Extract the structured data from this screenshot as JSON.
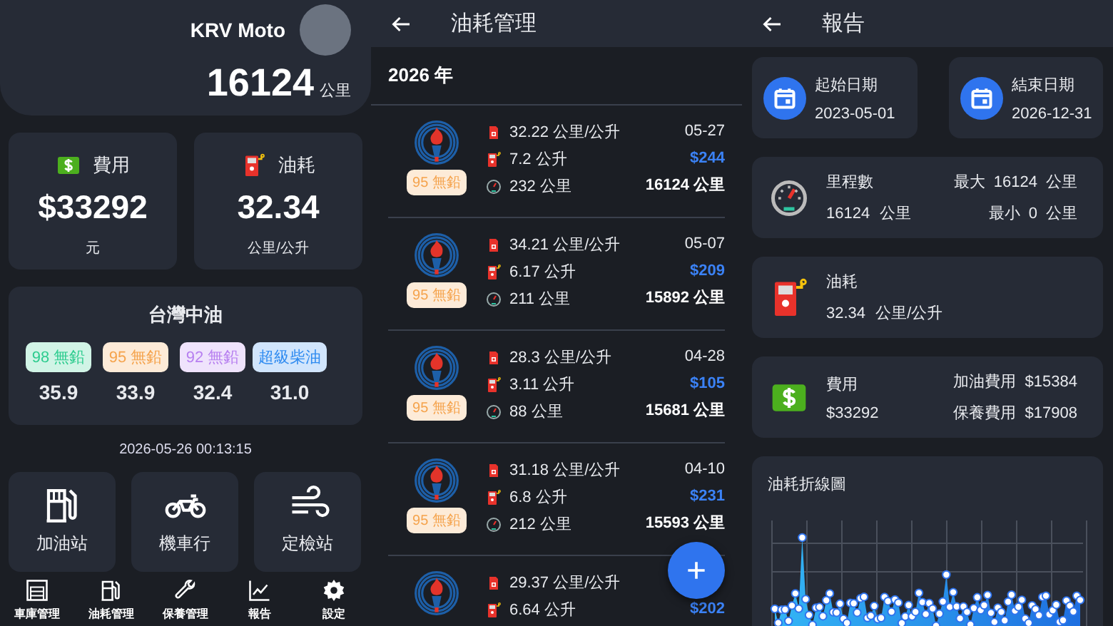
{
  "home": {
    "vehicle_name": "KRV Moto",
    "odometer": "16124",
    "odometer_unit": "公里",
    "stats": [
      {
        "kind": "cost",
        "label": "費用",
        "value": "$33292",
        "unit": "元"
      },
      {
        "kind": "fuel",
        "label": "油耗",
        "value": "32.34",
        "unit": "公里/公升"
      }
    ],
    "prices": {
      "title": "台灣中油",
      "items": [
        {
          "label": "98 無鉛",
          "color": "#2ecc8f",
          "price": "35.9"
        },
        {
          "label": "95 無鉛",
          "color": "#f5a34c",
          "price": "33.9"
        },
        {
          "label": "92 無鉛",
          "color": "#b77ff0",
          "price": "32.4"
        },
        {
          "label": "超級柴油",
          "color": "#2f8bf0",
          "price": "31.0"
        }
      ]
    },
    "timestamp": "2026-05-26 00:13:15",
    "shortcuts": [
      {
        "kind": "gas_station",
        "label": "加油站"
      },
      {
        "kind": "motorcycle",
        "label": "機車行"
      },
      {
        "kind": "inspection",
        "label": "定檢站"
      }
    ],
    "nav": [
      {
        "kind": "garage",
        "label": "車庫管理"
      },
      {
        "kind": "fuel",
        "label": "油耗管理"
      },
      {
        "kind": "maintenance",
        "label": "保養管理"
      },
      {
        "kind": "report",
        "label": "報告"
      },
      {
        "kind": "settings",
        "label": "設定"
      }
    ]
  },
  "fuel_log": {
    "title": "油耗管理",
    "year": "2026 年",
    "records": [
      {
        "fuel": "95 無鉛",
        "color": "#f5a34c",
        "efficiency": "32.22 公里/公升",
        "liters": "7.2 公升",
        "distance": "232 公里",
        "date": "05-27",
        "cost": "$244",
        "odometer": "16124 公里"
      },
      {
        "fuel": "95 無鉛",
        "color": "#f5a34c",
        "efficiency": "34.21 公里/公升",
        "liters": "6.17 公升",
        "distance": "211 公里",
        "date": "05-07",
        "cost": "$209",
        "odometer": "15892 公里"
      },
      {
        "fuel": "95 無鉛",
        "color": "#f5a34c",
        "efficiency": "28.3 公里/公升",
        "liters": "3.11 公升",
        "distance": "88 公里",
        "date": "04-28",
        "cost": "$105",
        "odometer": "15681 公里"
      },
      {
        "fuel": "95 無鉛",
        "color": "#f5a34c",
        "efficiency": "31.18 公里/公升",
        "liters": "6.8 公升",
        "distance": "212 公里",
        "date": "04-10",
        "cost": "$231",
        "odometer": "15593 公里"
      },
      {
        "efficiency": "29.37 公里/公升",
        "liters": "6.64 公升",
        "cost": "$202"
      }
    ]
  },
  "report": {
    "title": "報告",
    "dates": [
      {
        "label": "起始日期",
        "value": "2023-05-01"
      },
      {
        "label": "結束日期",
        "value": "2026-12-31"
      }
    ],
    "cards": [
      {
        "kind": "mileage",
        "label": "里程數",
        "value": "16124 公里",
        "extra": [
          "最大 16124 公里",
          "最小 0 公里"
        ]
      },
      {
        "kind": "fuel",
        "label": "油耗",
        "value": "32.34 公里/公升"
      },
      {
        "kind": "cost",
        "label": "費用",
        "value": "$33292",
        "extra": [
          "加油費用 $15384",
          "保養費用 $17908"
        ]
      }
    ],
    "chart_title": "油耗折線圖"
  }
}
